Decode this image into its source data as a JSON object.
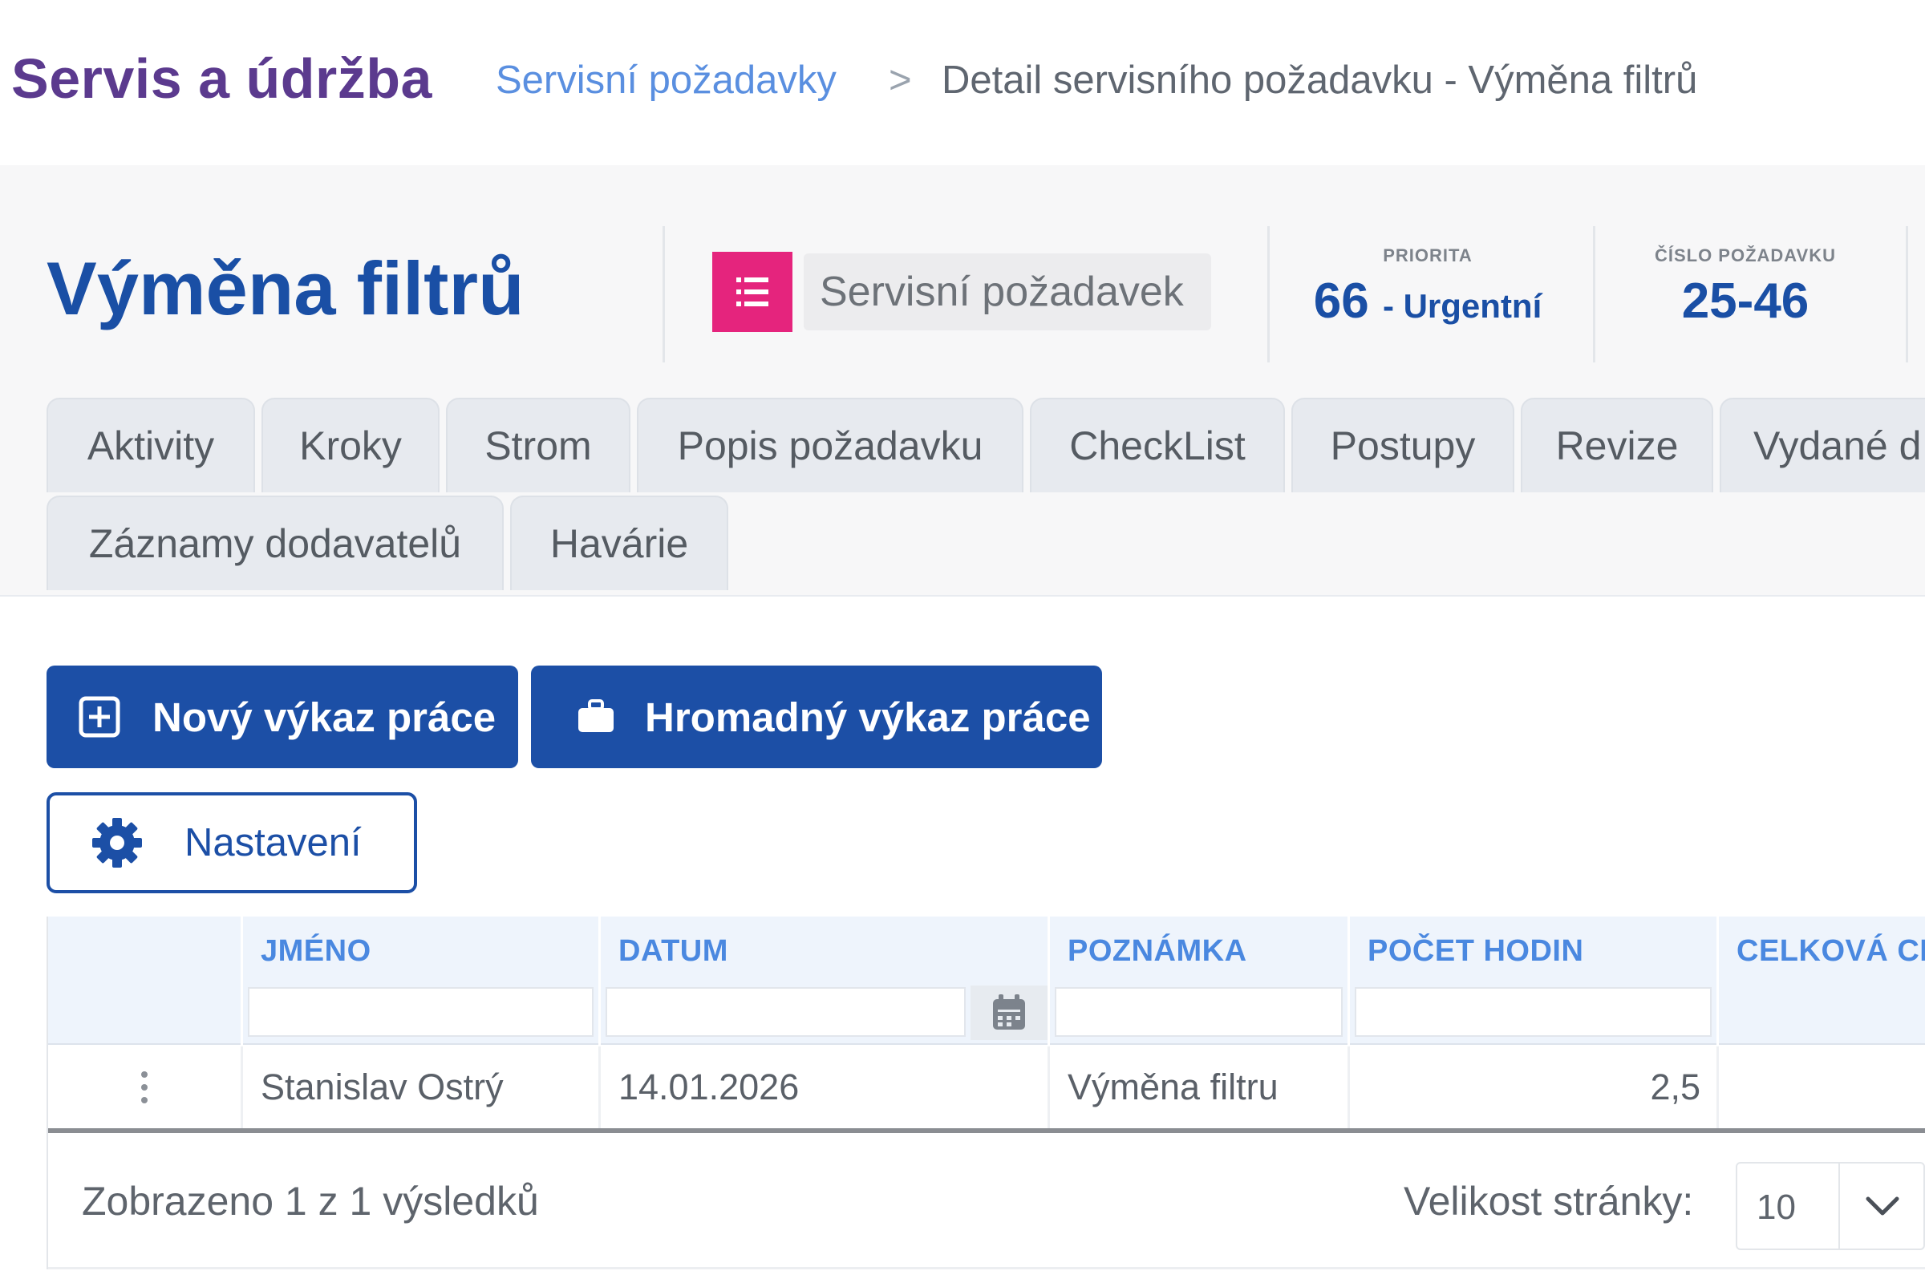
{
  "header": {
    "app_title": "Servis a údržba",
    "breadcrumb": {
      "link": "Servisní požadavky",
      "separator": ">",
      "current": "Detail servisního požadavku - Výměna filtrů"
    }
  },
  "request": {
    "title": "Výměna filtrů",
    "type_label": "Servisní požadavek",
    "type_icon": "list-icon",
    "type_color": "#e5247d",
    "priority": {
      "caption": "PRIORITA",
      "value": "66",
      "label": "- Urgentní"
    },
    "number": {
      "caption": "ČÍSLO POŽADAVKU",
      "value": "25-46"
    }
  },
  "tabs": [
    {
      "label": "Aktivity"
    },
    {
      "label": "Kroky"
    },
    {
      "label": "Strom"
    },
    {
      "label": "Popis požadavku"
    },
    {
      "label": "CheckList"
    },
    {
      "label": "Postupy"
    },
    {
      "label": "Revize"
    },
    {
      "label": "Vydané d"
    },
    {
      "label": "Záznamy dodavatelů"
    },
    {
      "label": "Havárie"
    }
  ],
  "actions": {
    "new_report": {
      "label": "Nový výkaz práce",
      "icon": "plus-square-icon"
    },
    "bulk_report": {
      "label": "Hromadný výkaz práce",
      "icon": "briefcase-icon"
    },
    "settings": {
      "label": "Nastavení",
      "icon": "gear-icon"
    }
  },
  "grid": {
    "columns": [
      "JMÉNO",
      "DATUM",
      "POZNÁMKA",
      "POČET HODIN",
      "CELKOVÁ CE"
    ],
    "rows": [
      {
        "name": "Stanislav Ostrý",
        "date": "14.01.2026",
        "note": "Výměna filtru",
        "hours": "2,5",
        "total": ""
      }
    ],
    "footer": {
      "count": "Zobrazeno 1 z 1 výsledků",
      "page_size_label": "Velikost stránky:",
      "page_size": "10"
    }
  },
  "colors": {
    "primary": "#1c4fa6",
    "app_title": "#5b3a8e",
    "header_caption": "#4a88e0"
  }
}
